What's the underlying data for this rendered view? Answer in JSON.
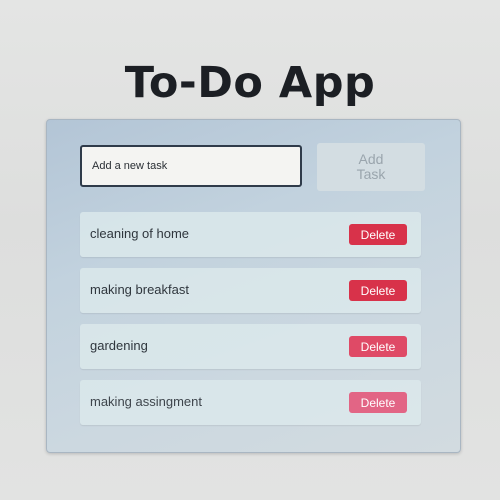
{
  "app": {
    "title": "To-Do App"
  },
  "form": {
    "input_placeholder": "Add a new task",
    "input_value": "",
    "add_button_label": "Add Task"
  },
  "tasks": [
    {
      "label": "cleaning of home",
      "delete_label": "Delete"
    },
    {
      "label": "making breakfast",
      "delete_label": "Delete"
    },
    {
      "label": "gardening",
      "delete_label": "Delete"
    },
    {
      "label": "making assingment",
      "delete_label": "Delete"
    }
  ],
  "colors": {
    "delete_button": "#d8324a",
    "panel_background": "#c2d2de",
    "title_text": "#1c1f24"
  }
}
